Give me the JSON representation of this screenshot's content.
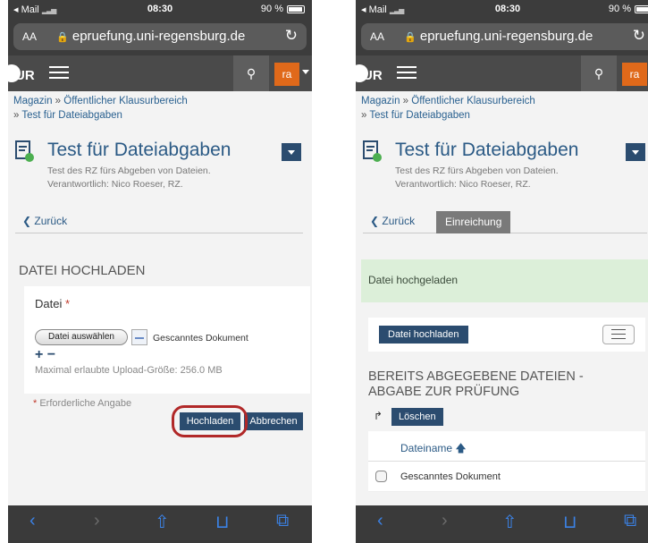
{
  "status": {
    "carrier": "◂ Mail",
    "time": "08:30",
    "battery": "90 %"
  },
  "browser": {
    "aa": "AA",
    "url": "epruefung.uni-regensburg.de"
  },
  "header": {
    "logo": "UR",
    "user_badge": "ra"
  },
  "breadcrumb": {
    "item1": "Magazin",
    "sep": "»",
    "item2": "Öffentlicher Klausurbereich",
    "item3": "Test für Dateiabgaben"
  },
  "title": {
    "text": "Test für Dateiabgaben",
    "subtitle1": "Test des RZ fürs Abgeben von Dateien.",
    "subtitle2": "Verantwortlich: Nico Roeser, RZ."
  },
  "tabs": {
    "back": "Zurück",
    "active": "Einreichung"
  },
  "upload_form": {
    "heading": "DATEI HOCHLADEN",
    "file_label": "Datei",
    "required_star": "*",
    "choose_button": "Datei auswählen",
    "chosen_file": "Gescanntes Dokument",
    "plus_minus": "+ −",
    "max_size": "Maximal erlaubte Upload-Größe: 256.0 MB",
    "required_note": "Erforderliche Angabe",
    "upload_button": "Hochladen",
    "cancel_button": "Abbrechen"
  },
  "result_view": {
    "success_message": "Datei hochgeladen",
    "upload_button": "Datei hochladen",
    "section_heading": "BEREITS ABGEGEBENE DATEIEN - ABGABE ZUR PRÜFUNG",
    "delete_button": "Löschen",
    "column_header": "Dateiname",
    "rows": [
      {
        "name": "Gescanntes Dokument"
      }
    ]
  },
  "icons": {
    "back": "‹",
    "forward": "›",
    "share": "⇧",
    "bookmarks": "⊔",
    "tabs": "⧉",
    "search": "⚲",
    "sort_up": "🡅",
    "delete_arrow": "↱",
    "reload": "↻",
    "lock": "🔒",
    "chevron_left": "❮"
  },
  "colors": {
    "primary": "#2b4c6f",
    "accent": "#e0691a",
    "link": "#2b5a85",
    "success_bg": "#dcefd9",
    "highlight": "#b12828"
  }
}
